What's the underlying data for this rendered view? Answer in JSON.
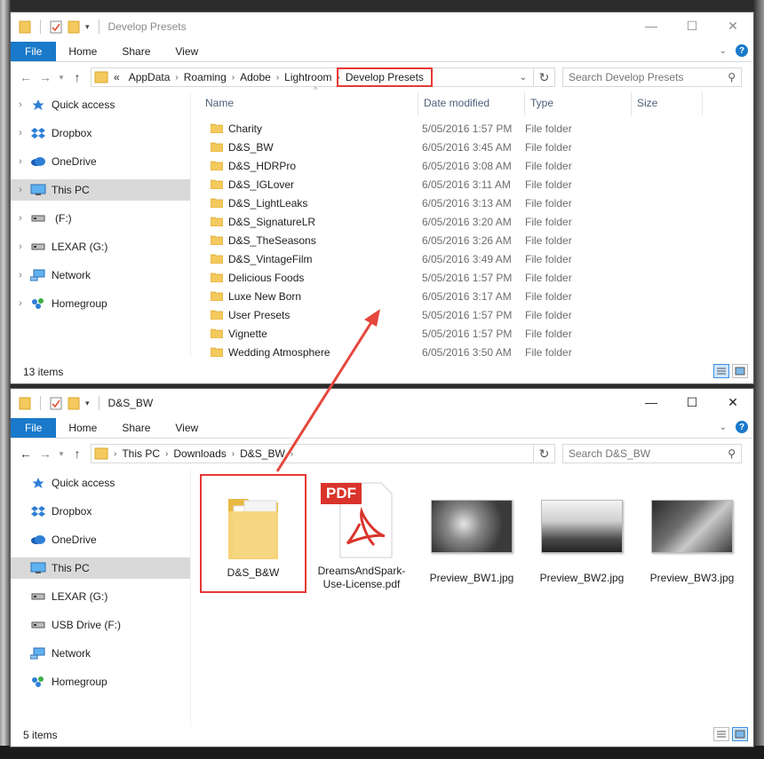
{
  "window1": {
    "title": "Develop Presets",
    "ribbon_tabs": [
      "File",
      "Home",
      "Share",
      "View"
    ],
    "path": [
      "AppData",
      "Roaming",
      "Adobe",
      "Lightroom",
      "Develop Presets"
    ],
    "path_prefix": "«",
    "search_placeholder": "Search Develop Presets",
    "nav_items": [
      {
        "label": "Quick access",
        "icon": "star-icon"
      },
      {
        "label": "Dropbox",
        "icon": "dropbox-icon"
      },
      {
        "label": "OneDrive",
        "icon": "onedrive-icon"
      },
      {
        "label": "This PC",
        "icon": "computer-icon",
        "selected": true
      },
      {
        "label": "(F:)",
        "icon": "drive-icon"
      },
      {
        "label": "LEXAR (G:)",
        "icon": "drive-icon"
      },
      {
        "label": "Network",
        "icon": "network-icon"
      },
      {
        "label": "Homegroup",
        "icon": "homegroup-icon"
      }
    ],
    "columns": [
      "Name",
      "Date modified",
      "Type",
      "Size"
    ],
    "files": [
      {
        "name": "Charity",
        "date": "5/05/2016 1:57 PM",
        "type": "File folder"
      },
      {
        "name": "D&S_BW",
        "date": "6/05/2016 3:45 AM",
        "type": "File folder"
      },
      {
        "name": "D&S_HDRPro",
        "date": "6/05/2016 3:08 AM",
        "type": "File folder"
      },
      {
        "name": "D&S_IGLover",
        "date": "6/05/2016 3:11 AM",
        "type": "File folder"
      },
      {
        "name": "D&S_LightLeaks",
        "date": "6/05/2016 3:13 AM",
        "type": "File folder"
      },
      {
        "name": "D&S_SignatureLR",
        "date": "6/05/2016 3:20 AM",
        "type": "File folder"
      },
      {
        "name": "D&S_TheSeasons",
        "date": "6/05/2016 3:26 AM",
        "type": "File folder"
      },
      {
        "name": "D&S_VintageFilm",
        "date": "6/05/2016 3:49 AM",
        "type": "File folder"
      },
      {
        "name": "Delicious Foods",
        "date": "5/05/2016 1:57 PM",
        "type": "File folder"
      },
      {
        "name": "Luxe New Born",
        "date": "6/05/2016 3:17 AM",
        "type": "File folder"
      },
      {
        "name": "User Presets",
        "date": "5/05/2016 1:57 PM",
        "type": "File folder"
      },
      {
        "name": "Vignette",
        "date": "5/05/2016 1:57 PM",
        "type": "File folder"
      },
      {
        "name": "Wedding Atmosphere",
        "date": "6/05/2016 3:50 AM",
        "type": "File folder"
      }
    ],
    "status": "13 items"
  },
  "window2": {
    "title": "D&S_BW",
    "ribbon_tabs": [
      "File",
      "Home",
      "Share",
      "View"
    ],
    "path": [
      "This PC",
      "Downloads",
      "D&S_BW"
    ],
    "search_placeholder": "Search D&S_BW",
    "nav_items": [
      {
        "label": "Quick access",
        "icon": "star-icon"
      },
      {
        "label": "Dropbox",
        "icon": "dropbox-icon"
      },
      {
        "label": "OneDrive",
        "icon": "onedrive-icon"
      },
      {
        "label": "This PC",
        "icon": "computer-icon",
        "selected": true
      },
      {
        "label": "LEXAR (G:)",
        "icon": "drive-icon"
      },
      {
        "label": "USB Drive (F:)",
        "icon": "drive-icon"
      },
      {
        "label": "Network",
        "icon": "network-icon"
      },
      {
        "label": "Homegroup",
        "icon": "homegroup-icon"
      }
    ],
    "items": [
      {
        "name": "D&S_B&W",
        "kind": "folder"
      },
      {
        "name": "DreamsAndSpark-Use-License.pdf",
        "kind": "pdf",
        "badge": "PDF"
      },
      {
        "name": "Preview_BW1.jpg",
        "kind": "image"
      },
      {
        "name": "Preview_BW2.jpg",
        "kind": "image"
      },
      {
        "name": "Preview_BW3.jpg",
        "kind": "image"
      }
    ],
    "status": "5 items"
  },
  "colors": {
    "accent": "#1979ca",
    "highlight": "#e53935",
    "selection": "#d9d9d9",
    "folder": "#f4c95d"
  }
}
